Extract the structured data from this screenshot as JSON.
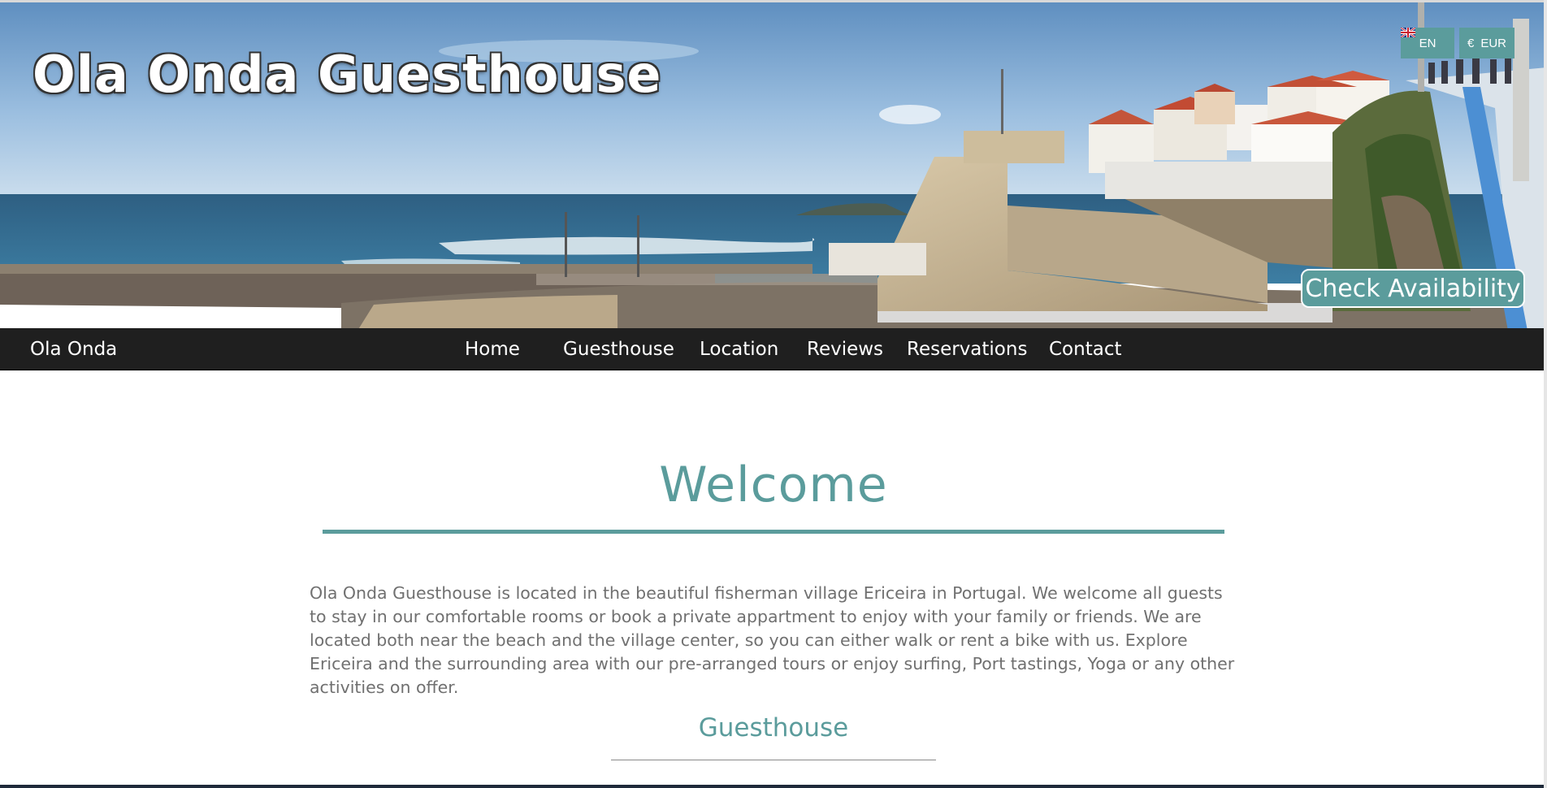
{
  "header": {
    "site_title": "Ola Onda Guesthouse",
    "language_code": "EN",
    "currency_symbol": "€",
    "currency_code": "EUR",
    "check_availability_label": "Check Availability"
  },
  "nav": {
    "brand": "Ola Onda",
    "items": [
      {
        "label": "Home"
      },
      {
        "label": "Guesthouse"
      },
      {
        "label": "Location"
      },
      {
        "label": "Reviews"
      },
      {
        "label": "Reservations"
      },
      {
        "label": "Contact"
      }
    ]
  },
  "main": {
    "welcome_heading": "Welcome",
    "intro_text": "Ola Onda Guesthouse is located in the beautiful fisherman village Ericeira in Portugal. We welcome all guests to stay in our comfortable rooms or book a private appartment to enjoy with your family or friends. We are located both near the beach and the village center, so you can either walk or rent a bike with us. Explore Ericeira and the surrounding area with our pre-arranged tours or enjoy surfing, Port tastings, Yoga or any other activities on offer.",
    "section_heading": "Guesthouse"
  },
  "colors": {
    "accent": "#5b9c9c",
    "nav_background": "#1f1f1f",
    "body_text": "#707070"
  },
  "icons": {
    "language_flag": "uk-flag-icon",
    "currency": "euro-icon"
  }
}
